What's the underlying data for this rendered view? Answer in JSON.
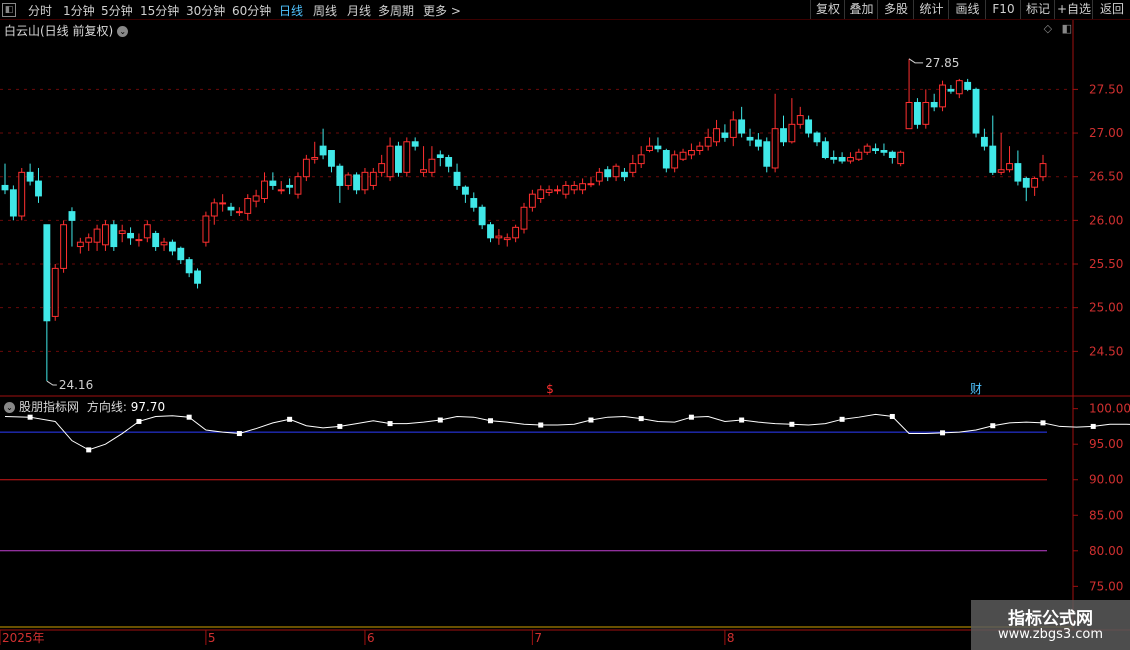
{
  "toolbar": {
    "left_btn": "◧",
    "periods": [
      "分时",
      "1分钟",
      "5分钟",
      "15分钟",
      "30分钟",
      "60分钟",
      "日线",
      "周线",
      "月线",
      "多周期",
      "更多 >"
    ],
    "active_period": "日线",
    "right_buttons": [
      "复权",
      "叠加",
      "多股",
      "统计",
      "画线",
      "F10",
      "标记",
      "+自选",
      "返回"
    ]
  },
  "main": {
    "title": "白云山(日线 前复权)",
    "high_label": "27.85",
    "low_label": "24.16",
    "marker_dollar": "$",
    "marker_cai": "财"
  },
  "indicator": {
    "name": "股朋指标网",
    "line_label": "方向线:",
    "line_value": "97.70"
  },
  "watermark": {
    "line1": "指标公式网",
    "line2": "www.zbgs3.com"
  },
  "colors": {
    "up": "#ff3030",
    "down": "#40e8e8",
    "direction_line": "#ffffff",
    "blue_line": "#2c3cff",
    "red_line": "#d01818",
    "magenta_line": "#c040d0"
  },
  "chart_data": [
    {
      "type": "candlestick",
      "title": "白云山(日线 前复权)",
      "y_axis_ticks": [
        27.5,
        27.0,
        26.5,
        26.0,
        25.5,
        25.0,
        24.5
      ],
      "ylim": [
        24.0,
        28.1
      ],
      "x_ticks": [
        "2025年",
        "5",
        "6",
        "7",
        "8"
      ],
      "x_tick_index": [
        0,
        24,
        43,
        63,
        86
      ],
      "annotations": [
        {
          "text": "27.85",
          "value": 27.85
        },
        {
          "text": "24.16",
          "value": 24.16
        }
      ],
      "candles": [
        [
          26.4,
          26.35,
          26.65,
          26.3
        ],
        [
          26.35,
          26.05,
          26.4,
          26.0
        ],
        [
          26.05,
          26.55,
          26.6,
          26.0
        ],
        [
          26.55,
          26.45,
          26.65,
          26.4
        ],
        [
          26.45,
          26.28,
          26.6,
          26.2
        ],
        [
          25.95,
          24.85,
          25.95,
          24.16
        ],
        [
          24.9,
          25.45,
          25.5,
          24.85
        ],
        [
          25.45,
          25.95,
          26.0,
          25.4
        ],
        [
          26.1,
          26.0,
          26.15,
          25.7
        ],
        [
          25.7,
          25.75,
          25.8,
          25.62
        ],
        [
          25.75,
          25.8,
          25.85,
          25.65
        ],
        [
          25.75,
          25.9,
          25.95,
          25.65
        ],
        [
          25.72,
          25.95,
          26.0,
          25.65
        ],
        [
          25.95,
          25.7,
          26.0,
          25.65
        ],
        [
          25.85,
          25.88,
          25.95,
          25.75
        ],
        [
          25.85,
          25.8,
          25.92,
          25.72
        ],
        [
          25.78,
          25.78,
          25.85,
          25.7
        ],
        [
          25.8,
          25.95,
          26.0,
          25.75
        ],
        [
          25.85,
          25.7,
          25.88,
          25.65
        ],
        [
          25.72,
          25.75,
          25.8,
          25.65
        ],
        [
          25.75,
          25.65,
          25.78,
          25.6
        ],
        [
          25.68,
          25.55,
          25.7,
          25.5
        ],
        [
          25.55,
          25.4,
          25.58,
          25.35
        ],
        [
          25.42,
          25.28,
          25.45,
          25.22
        ],
        [
          25.75,
          26.05,
          26.1,
          25.7
        ],
        [
          26.05,
          26.2,
          26.25,
          25.95
        ],
        [
          26.2,
          26.2,
          26.3,
          26.1
        ],
        [
          26.15,
          26.12,
          26.2,
          26.05
        ],
        [
          26.1,
          26.1,
          26.15,
          26.05
        ],
        [
          26.08,
          26.25,
          26.3,
          26.0
        ],
        [
          26.22,
          26.28,
          26.35,
          26.15
        ],
        [
          26.25,
          26.45,
          26.55,
          26.2
        ],
        [
          26.45,
          26.4,
          26.55,
          26.35
        ],
        [
          26.35,
          26.35,
          26.45,
          26.3
        ],
        [
          26.4,
          26.38,
          26.48,
          26.3
        ],
        [
          26.3,
          26.5,
          26.55,
          26.25
        ],
        [
          26.5,
          26.7,
          26.75,
          26.45
        ],
        [
          26.7,
          26.72,
          26.9,
          26.65
        ],
        [
          26.85,
          26.75,
          27.05,
          26.7
        ],
        [
          26.8,
          26.62,
          26.8,
          26.55
        ],
        [
          26.62,
          26.4,
          26.65,
          26.2
        ],
        [
          26.4,
          26.52,
          26.55,
          26.35
        ],
        [
          26.52,
          26.35,
          26.55,
          26.3
        ],
        [
          26.35,
          26.55,
          26.6,
          26.3
        ],
        [
          26.4,
          26.55,
          26.6,
          26.35
        ],
        [
          26.55,
          26.65,
          26.75,
          26.5
        ],
        [
          26.5,
          26.85,
          26.95,
          26.45
        ],
        [
          26.85,
          26.55,
          26.9,
          26.5
        ],
        [
          26.55,
          26.9,
          26.95,
          26.5
        ],
        [
          26.9,
          26.85,
          26.95,
          26.8
        ],
        [
          26.55,
          26.58,
          26.85,
          26.5
        ],
        [
          26.55,
          26.7,
          26.85,
          26.5
        ],
        [
          26.75,
          26.72,
          26.8,
          26.62
        ],
        [
          26.72,
          26.62,
          26.75,
          26.55
        ],
        [
          26.55,
          26.4,
          26.65,
          26.35
        ],
        [
          26.38,
          26.3,
          26.4,
          26.2
        ],
        [
          26.25,
          26.15,
          26.32,
          26.1
        ],
        [
          26.15,
          25.95,
          26.18,
          25.9
        ],
        [
          25.95,
          25.8,
          25.98,
          25.75
        ],
        [
          25.8,
          25.82,
          25.9,
          25.72
        ],
        [
          25.78,
          25.8,
          25.85,
          25.7
        ],
        [
          25.8,
          25.92,
          25.95,
          25.75
        ],
        [
          25.9,
          26.15,
          26.2,
          25.85
        ],
        [
          26.15,
          26.3,
          26.35,
          26.1
        ],
        [
          26.25,
          26.35,
          26.4,
          26.2
        ],
        [
          26.32,
          26.35,
          26.4,
          26.28
        ],
        [
          26.35,
          26.35,
          26.4,
          26.3
        ],
        [
          26.3,
          26.4,
          26.45,
          26.25
        ],
        [
          26.35,
          26.4,
          26.45,
          26.3
        ],
        [
          26.35,
          26.42,
          26.48,
          26.3
        ],
        [
          26.42,
          26.42,
          26.5,
          26.38
        ],
        [
          26.45,
          26.55,
          26.6,
          26.4
        ],
        [
          26.58,
          26.5,
          26.62,
          26.45
        ],
        [
          26.5,
          26.62,
          26.65,
          26.45
        ],
        [
          26.55,
          26.5,
          26.6,
          26.45
        ],
        [
          26.55,
          26.65,
          26.75,
          26.5
        ],
        [
          26.65,
          26.75,
          26.85,
          26.6
        ],
        [
          26.8,
          26.85,
          26.95,
          26.78
        ],
        [
          26.85,
          26.82,
          26.95,
          26.78
        ],
        [
          26.8,
          26.6,
          26.82,
          26.55
        ],
        [
          26.6,
          26.75,
          26.8,
          26.55
        ],
        [
          26.7,
          26.78,
          26.82,
          26.68
        ],
        [
          26.75,
          26.8,
          26.88,
          26.7
        ],
        [
          26.8,
          26.85,
          26.9,
          26.75
        ],
        [
          26.85,
          26.95,
          27.05,
          26.8
        ],
        [
          26.9,
          27.05,
          27.15,
          26.85
        ],
        [
          27.0,
          26.95,
          27.1,
          26.9
        ],
        [
          26.95,
          27.15,
          27.25,
          26.85
        ],
        [
          27.15,
          27.0,
          27.3,
          26.95
        ],
        [
          26.95,
          26.92,
          27.05,
          26.85
        ],
        [
          26.92,
          26.85,
          27.0,
          26.8
        ],
        [
          26.9,
          26.62,
          26.95,
          26.55
        ],
        [
          26.6,
          27.05,
          27.45,
          26.55
        ],
        [
          27.05,
          26.9,
          27.2,
          26.85
        ],
        [
          26.9,
          27.1,
          27.4,
          26.88
        ],
        [
          27.1,
          27.2,
          27.3,
          27.05
        ],
        [
          27.15,
          27.0,
          27.2,
          26.95
        ],
        [
          27.0,
          26.9,
          27.02,
          26.85
        ],
        [
          26.9,
          26.72,
          26.95,
          26.7
        ],
        [
          26.72,
          26.7,
          26.8,
          26.65
        ],
        [
          26.72,
          26.68,
          26.78,
          26.65
        ],
        [
          26.68,
          26.72,
          26.78,
          26.65
        ],
        [
          26.7,
          26.78,
          26.82,
          26.68
        ],
        [
          26.78,
          26.85,
          26.88,
          26.75
        ],
        [
          26.82,
          26.8,
          26.88,
          26.76
        ],
        [
          26.8,
          26.78,
          26.88,
          26.74
        ],
        [
          26.78,
          26.72,
          26.8,
          26.65
        ],
        [
          26.65,
          26.78,
          26.8,
          26.62
        ],
        [
          27.05,
          27.35,
          27.85,
          27.05
        ],
        [
          27.35,
          27.1,
          27.4,
          27.05
        ],
        [
          27.1,
          27.35,
          27.5,
          27.05
        ],
        [
          27.35,
          27.3,
          27.45,
          27.25
        ],
        [
          27.3,
          27.55,
          27.6,
          27.25
        ],
        [
          27.5,
          27.48,
          27.55,
          27.45
        ],
        [
          27.45,
          27.6,
          27.62,
          27.4
        ],
        [
          27.58,
          27.5,
          27.62,
          27.48
        ],
        [
          27.5,
          27.0,
          27.52,
          26.95
        ],
        [
          26.95,
          26.85,
          27.05,
          26.8
        ],
        [
          26.85,
          26.55,
          27.2,
          26.52
        ],
        [
          26.55,
          26.58,
          27.0,
          26.52
        ],
        [
          26.58,
          26.65,
          26.85,
          26.55
        ],
        [
          26.65,
          26.45,
          26.8,
          26.4
        ],
        [
          26.48,
          26.38,
          26.5,
          26.22
        ],
        [
          26.38,
          26.48,
          26.5,
          26.28
        ],
        [
          26.5,
          26.65,
          26.75,
          26.45
        ]
      ],
      "markers": [
        {
          "text": "$",
          "index": 65,
          "color": "#ff3030"
        },
        {
          "text": "财",
          "index": 116,
          "color": "#4fc3ff"
        }
      ]
    },
    {
      "type": "line",
      "title": "股朋指标网",
      "y_axis_ticks": [
        100.0,
        95.0,
        90.0,
        85.0,
        80.0,
        75.0
      ],
      "ylim": [
        73.5,
        101.5
      ],
      "series": [
        {
          "name": "方向线",
          "color": "#ffffff",
          "x": [
            0,
            3,
            6,
            8,
            10,
            12,
            14,
            16,
            18,
            20,
            22,
            24,
            26,
            28,
            30,
            32,
            34,
            36,
            38,
            40,
            42,
            44,
            46,
            48,
            50,
            52,
            54,
            56,
            58,
            60,
            62,
            64,
            66,
            68,
            70,
            72,
            74,
            76,
            78,
            80,
            82,
            84,
            86,
            88,
            90,
            92,
            94,
            96,
            98,
            100,
            102,
            104,
            106,
            108,
            110,
            112,
            114,
            116,
            118,
            120,
            122,
            124,
            126,
            128,
            130,
            132,
            134,
            136
          ],
          "values": [
            98.9,
            98.8,
            98.2,
            95.5,
            94.2,
            95.0,
            96.5,
            98.2,
            98.9,
            99.0,
            98.8,
            97.0,
            96.7,
            96.5,
            97.2,
            98.0,
            98.5,
            97.6,
            97.3,
            97.5,
            97.9,
            98.3,
            97.9,
            97.9,
            98.1,
            98.4,
            98.9,
            98.8,
            98.3,
            98.1,
            97.8,
            97.7,
            97.7,
            97.8,
            98.4,
            98.8,
            98.9,
            98.6,
            98.2,
            98.1,
            98.8,
            98.9,
            98.2,
            98.4,
            98.1,
            97.9,
            97.8,
            97.7,
            97.9,
            98.5,
            98.8,
            99.2,
            98.9,
            96.5,
            96.5,
            96.6,
            96.7,
            97.0,
            97.6,
            98.0,
            98.1,
            98.0,
            97.5,
            97.4,
            97.5,
            97.8,
            97.8,
            97.7
          ]
        },
        {
          "name": "",
          "color": "#2c3cff",
          "constant": 96.7
        },
        {
          "name": "",
          "color": "#d01818",
          "constant": 90.0
        },
        {
          "name": "",
          "color": "#c040d0",
          "constant": 80.0
        }
      ]
    }
  ]
}
